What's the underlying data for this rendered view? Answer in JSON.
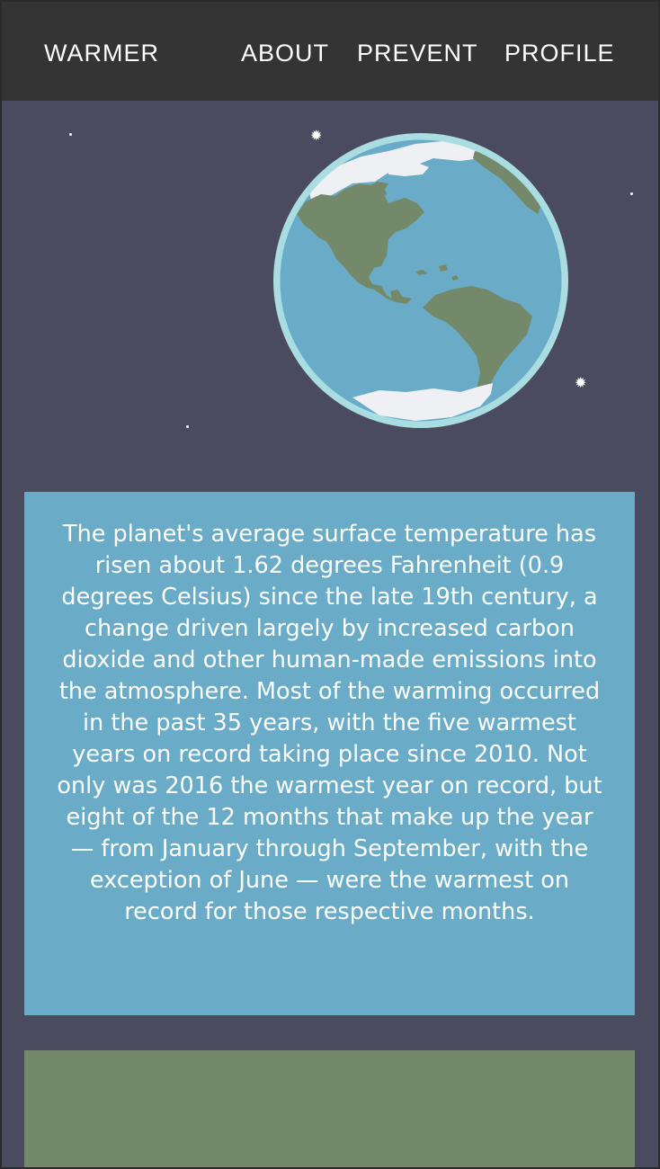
{
  "nav": {
    "brand": "WARMER",
    "links": [
      "ABOUT",
      "PREVENT",
      "PROFILE"
    ]
  },
  "colors": {
    "page_background": "#4a4b5e",
    "navbar": "#343434",
    "info_card": "#6aacc7",
    "green_card": "#74896a",
    "ocean": "#6aacc7",
    "land": "#74896a",
    "ice": "#eef0f4",
    "globe_rim": "#a9dde2"
  },
  "hero": {
    "image": "earth-globe-illustration"
  },
  "info": {
    "text": "The planet's average surface temperature has risen about 1.62 degrees Fahrenheit (0.9 degrees Celsius) since the late 19th century, a change driven largely by increased carbon dioxide and other human-made emissions into the atmosphere. Most of the warming occurred in the past 35 years, with the five warmest years on record taking place since 2010. Not only was 2016 the warmest year on record, but eight of the 12 months that make up the year — from January through September, with the exception of June — were the warmest on record for those respective months."
  }
}
